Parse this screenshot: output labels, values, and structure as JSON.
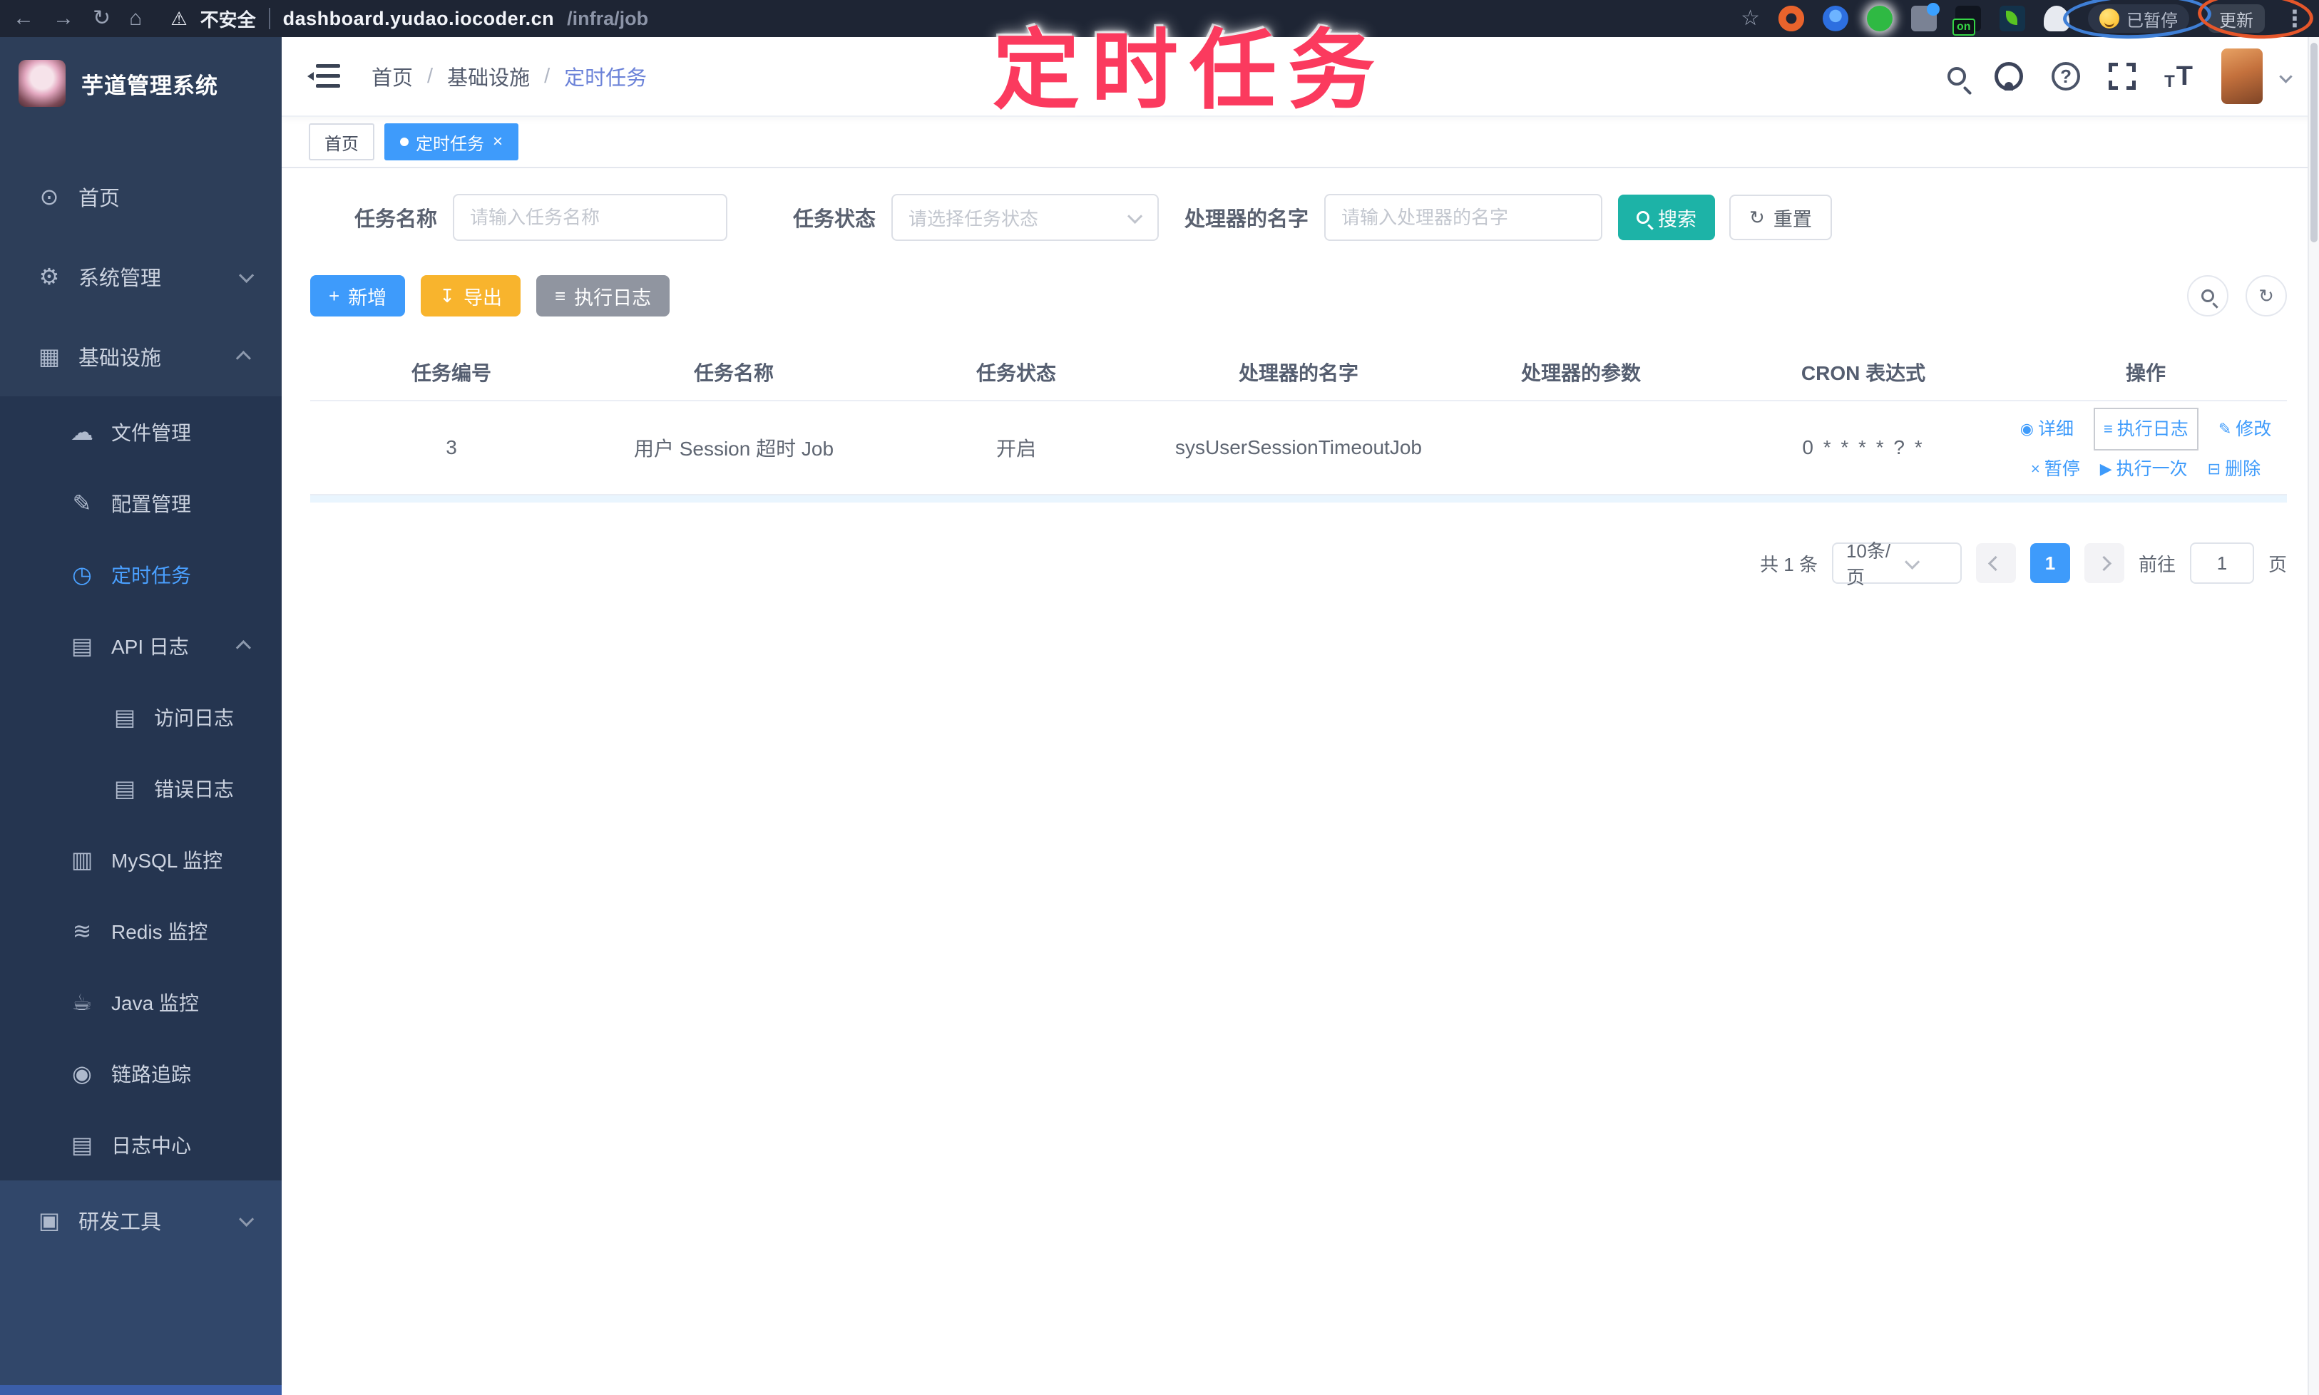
{
  "browser": {
    "security_label": "不安全",
    "url_host": "dashboard.yudao.iocoder.cn",
    "url_path": "/infra/job",
    "paused_label": "已暂停",
    "update_label": "更新",
    "on_badge": "on"
  },
  "annotation": {
    "text": "定时任务",
    "color": "#fb3a5e"
  },
  "icons": {
    "back": "←",
    "forward": "→",
    "reload": "↻",
    "home": "⌂",
    "warning": "⚠",
    "star": "☆",
    "kebab": "⋮",
    "sidebar_home": "⊙",
    "sidebar_system": "⚙",
    "sidebar_infra": "▦",
    "sidebar_file": "☁",
    "sidebar_config": "✎",
    "sidebar_job": "◷",
    "sidebar_api_log": "▤",
    "sidebar_access_log": "▤",
    "sidebar_error_log": "▤",
    "sidebar_mysql": "▥",
    "sidebar_redis": "≋",
    "sidebar_java": "☕",
    "sidebar_trace": "◉",
    "sidebar_log_center": "▤",
    "sidebar_devtool": "▣",
    "reset": "↻",
    "add": "+",
    "export": "↧",
    "log": "≡",
    "refresh": "↻",
    "action_detail": "◉",
    "action_log": "≡",
    "action_edit": "✎",
    "action_pause": "×",
    "action_run": "▶",
    "action_delete": "⊟"
  },
  "sidebar": {
    "app_title": "芋道管理系统",
    "items": [
      {
        "icon": "dashboard-icon",
        "label": "首页"
      },
      {
        "icon": "gear-icon",
        "label": "系统管理"
      },
      {
        "icon": "monitor-icon",
        "label": "基础设施"
      },
      {
        "icon": "cloud-upload-icon",
        "label": "文件管理"
      },
      {
        "icon": "edit-icon",
        "label": "配置管理"
      },
      {
        "icon": "clock-icon",
        "label": "定时任务"
      },
      {
        "icon": "log-icon",
        "label": "API 日志"
      },
      {
        "icon": "log-icon",
        "label": "访问日志"
      },
      {
        "icon": "log-icon",
        "label": "错误日志"
      },
      {
        "icon": "database-icon",
        "label": "MySQL 监控"
      },
      {
        "icon": "layers-icon",
        "label": "Redis 监控"
      },
      {
        "icon": "java-icon",
        "label": "Java 监控"
      },
      {
        "icon": "eye-icon",
        "label": "链路追踪"
      },
      {
        "icon": "log-icon",
        "label": "日志中心"
      },
      {
        "icon": "briefcase-icon",
        "label": "研发工具"
      }
    ]
  },
  "header": {
    "breadcrumb": [
      {
        "label": "首页"
      },
      {
        "label": "基础设施"
      },
      {
        "label": "定时任务"
      }
    ],
    "separator": "/"
  },
  "tags": {
    "items": [
      {
        "label": "首页",
        "active": false
      },
      {
        "label": "定时任务",
        "active": true
      }
    ],
    "close_glyph": "×"
  },
  "filters": {
    "task_name_label": "任务名称",
    "task_name_placeholder": "请输入任务名称",
    "task_status_label": "任务状态",
    "task_status_placeholder": "请选择任务状态",
    "handler_name_label": "处理器的名字",
    "handler_name_placeholder": "请输入处理器的名字",
    "search_label": "搜索",
    "reset_label": "重置"
  },
  "toolbar": {
    "add_label": "新增",
    "export_label": "导出",
    "job_log_label": "执行日志"
  },
  "table": {
    "headers": [
      "任务编号",
      "任务名称",
      "任务状态",
      "处理器的名字",
      "处理器的参数",
      "CRON 表达式",
      "操作"
    ],
    "row": {
      "id": "3",
      "name": "用户 Session 超时 Job",
      "status": "开启",
      "handler": "sysUserSessionTimeoutJob",
      "params": "",
      "cron": "0 * * * * ? *"
    },
    "actions": [
      "详细",
      "执行日志",
      "修改",
      "暂停",
      "执行一次",
      "删除"
    ]
  },
  "pagination": {
    "total": "共 1 条",
    "page_size": "10条/页",
    "current_page": "1",
    "goto_label": "前往",
    "goto_value": "1",
    "page_unit": "页"
  },
  "colors": {
    "accent_blue": "#3e9bfb",
    "search_teal": "#1db3a7",
    "export_orange": "#f8b42d",
    "log_gray": "#9095a0",
    "annotation_pink": "#fb3a5e",
    "sidebar_bg": "#2d3e59"
  }
}
